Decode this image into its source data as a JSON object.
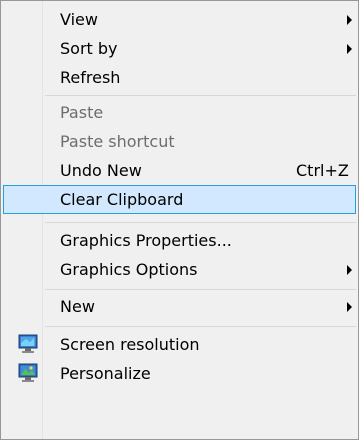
{
  "menu": {
    "items": [
      {
        "label": "View",
        "submenu": true,
        "enabled": true
      },
      {
        "label": "Sort by",
        "submenu": true,
        "enabled": true
      },
      {
        "label": "Refresh",
        "enabled": true
      },
      {
        "label": "Paste",
        "enabled": false
      },
      {
        "label": "Paste shortcut",
        "enabled": false
      },
      {
        "label": "Undo New",
        "shortcut": "Ctrl+Z",
        "enabled": true
      },
      {
        "label": "Clear Clipboard",
        "enabled": true,
        "highlighted": true
      },
      {
        "label": "Graphics Properties...",
        "enabled": true
      },
      {
        "label": "Graphics Options",
        "submenu": true,
        "enabled": true
      },
      {
        "label": "New",
        "submenu": true,
        "enabled": true
      },
      {
        "label": "Screen resolution",
        "icon": "screen-resolution-icon",
        "enabled": true
      },
      {
        "label": "Personalize",
        "icon": "personalize-icon",
        "enabled": true
      }
    ]
  },
  "colors": {
    "highlight_fill": "#d1e8ff",
    "highlight_border": "#26a0da",
    "disabled_text": "#6d6d6d",
    "menu_background": "#f0f0f0"
  }
}
